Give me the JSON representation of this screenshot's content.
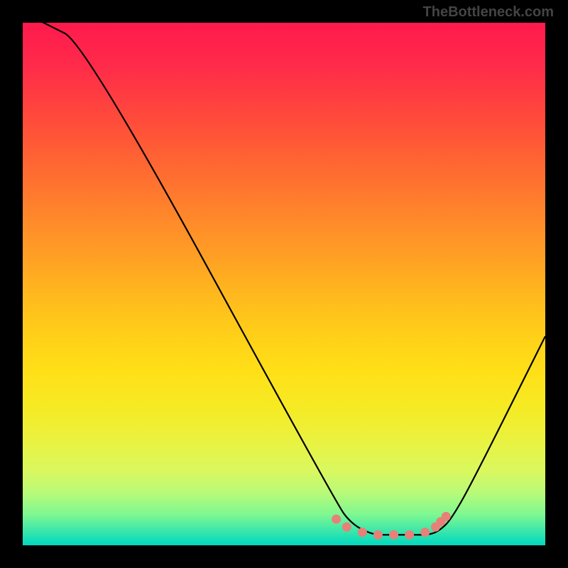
{
  "watermark": "TheBottleneck.com",
  "chart_data": {
    "type": "line",
    "title": "",
    "xlabel": "",
    "ylabel": "",
    "xlim": [
      0,
      100
    ],
    "ylim": [
      0,
      100
    ],
    "series": [
      {
        "name": "curve",
        "x": [
          0,
          4,
          12,
          60,
          63,
          67,
          70,
          74,
          78,
          80,
          82,
          86,
          100
        ],
        "values": [
          102,
          100,
          96,
          8,
          4,
          2,
          2,
          2,
          2,
          3,
          5,
          12,
          40
        ]
      }
    ],
    "marker_points": {
      "x": [
        60,
        62,
        65,
        68,
        71,
        74,
        77,
        79,
        80,
        81
      ],
      "y": [
        5,
        3.5,
        2.5,
        2,
        2,
        2,
        2.5,
        3.5,
        4.5,
        5.5
      ]
    },
    "colors": {
      "curve": "#000000",
      "markers": "#e88078",
      "gradient_top": "#ff1a4d",
      "gradient_bottom": "#00d8c0"
    }
  }
}
